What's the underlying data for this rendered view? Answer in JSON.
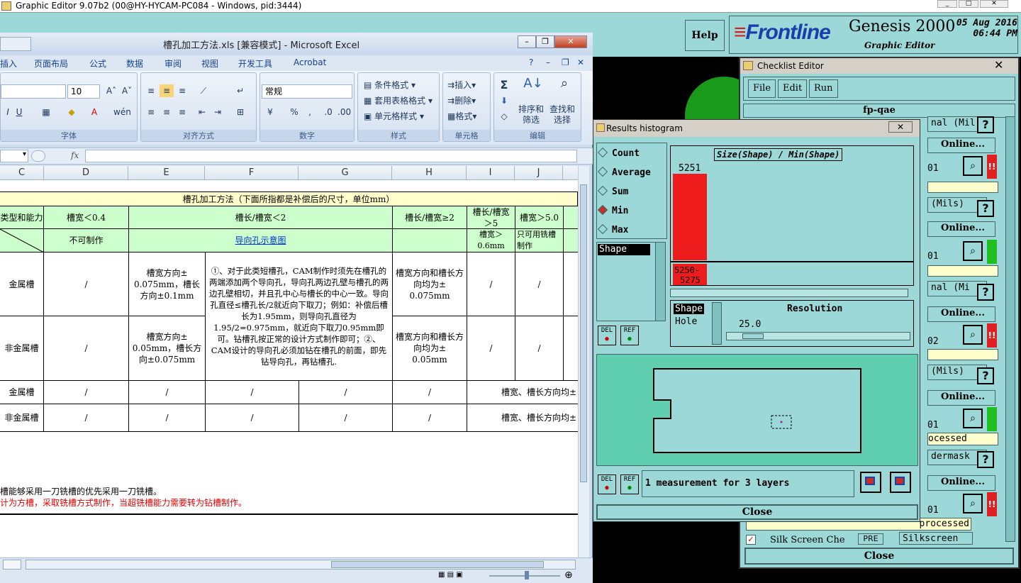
{
  "genesis": {
    "title": "Graphic Editor 9.07b2 (00@HY-HYCAM-PC084 - Windows, pid:3444)",
    "help": "Help",
    "logo": "Frontline",
    "product": "Genesis 2000",
    "subtitle": "Graphic Editor",
    "date": "05 Aug 2016",
    "time": "06:44 PM"
  },
  "excel": {
    "title": "槽孔加工方法.xls  [兼容模式] - Microsoft Excel",
    "tabs": [
      "插入",
      "页面布局",
      "公式",
      "数据",
      "审阅",
      "视图",
      "开发工具",
      "Acrobat"
    ],
    "font_size": "10",
    "number_format": "常规",
    "groups": [
      "字体",
      "对齐方式",
      "数字",
      "样式",
      "单元格",
      "编辑"
    ],
    "styles": {
      "cond": "条件格式",
      "table": "套用表格格式",
      "cell": "单元格样式"
    },
    "cells_grp": {
      "insert": "插入",
      "delete": "删除",
      "format": "格式"
    },
    "edit_grp": {
      "sort": "排序和",
      "sort2": "筛选",
      "find": "查找和",
      "find2": "选择"
    },
    "fx": "fx",
    "columns": [
      "C",
      "D",
      "E",
      "F",
      "G",
      "H",
      "I",
      "J"
    ],
    "sheet": {
      "title": "槽孔加工方法（下面所指都是补偿后的尺寸，单位mm）",
      "h_type": "类型和能力",
      "h_d": "槽宽＜0.4",
      "h_ef": "槽长/槽宽＜2",
      "h_h": "槽长/槽宽≥2",
      "h_i": "槽长/槽宽 ＞5",
      "h_j": "槽宽＞5.0",
      "r2_d": "不可制作",
      "r2_ef": "导向孔示意图",
      "r2_i": "槽宽＞ 0.6mm",
      "r2_j": "只可用铣槽制作",
      "r3_c": "金属槽",
      "r3_d": "/",
      "r3_e": "槽宽方向± 0.075mm，槽长方向±0.1mm",
      "r3_f": "①、对于此类短槽孔，CAM制作时须先在槽孔的两端添加两个导向孔，导向孔两边孔壁与槽孔的两边孔壁相切，并且孔中心与槽长的中心一致。导向孔直径≤槽孔长/2就近向下取刀；例如：补偿后槽长为1.95mm，则导向孔直径为1.95/2=0.975mm，就近向下取刀0.95mm即可。钻槽孔按正常的设计方式制作即可；②、CAM设计的导向孔必须加钻在槽孔的前面，即先钻导向孔，再钻槽孔.",
      "r3_h": "槽宽方向和槽长方向均为± 0.075mm",
      "r3_i": "/",
      "r3_j": "/",
      "r4_c": "非金属槽",
      "r4_d": "/",
      "r4_e": "槽宽方向± 0.05mm，槽长方向±0.075mm",
      "r4_h": "槽宽方向和槽长方向均为± 0.05mm",
      "r4_i": "/",
      "r4_j": "/",
      "r5_c": "金属槽",
      "r5_d": "/",
      "r5_e": "/",
      "r5_f": "/",
      "r5_g": "/",
      "r5_h": "/",
      "r5_ij": "槽宽、槽长方向均±",
      "r6_c": "非金属槽",
      "r6_d": "/",
      "r6_e": "/",
      "r6_f": "/",
      "r6_g": "/",
      "r6_h": "/",
      "r6_ij": "槽宽、槽长方向均±",
      "note1": "槽能够采用一刀铣槽的优先采用一刀铣槽。",
      "note2": "计为方槽，采取铣槽方式制作，当超铣槽能力需要转为钻槽制作。"
    }
  },
  "checklist": {
    "title": "Checklist Editor",
    "menu": [
      "File",
      "Edit",
      "Run"
    ],
    "job": "fp-qae",
    "rows": [
      {
        "text": "nal (Mil",
        "online": "Online...",
        "status": "red",
        "num": "01"
      },
      {
        "text": "(Mils)",
        "online": "Online...",
        "status": "green",
        "num": "01"
      },
      {
        "text": "nal (Mi",
        "online": "Online...",
        "status": "red",
        "num": "02"
      },
      {
        "text": "(Mils)",
        "online": "Online...",
        "status": "green",
        "num": "01"
      },
      {
        "text": "dermask",
        "online": "Online...",
        "status": "red",
        "num": "01"
      }
    ],
    "processed": "ocessed",
    "processed2": "processed",
    "last_item": "Silk Screen Che",
    "last_pre": "PRE",
    "last_lbl": "Silkscreen",
    "close": "Close"
  },
  "histogram": {
    "title": "Results histogram",
    "modes": [
      "Count",
      "Average",
      "Sum",
      "Min",
      "Max"
    ],
    "selected_mode": "Min",
    "list_item": "Shape",
    "plot_title": "Size(Shape) / Min(Shape)",
    "bar_count": "5251",
    "bin_label": "5250- 5275",
    "types": [
      "Shape",
      "Hole"
    ],
    "resolution_label": "Resolution",
    "resolution_value": "25.0",
    "del": "DEL",
    "ref": "REF",
    "summary": "1 measurement for 3 layers",
    "close": "Close"
  },
  "chart_data": {
    "type": "bar",
    "title": "Size(Shape) / Min(Shape)",
    "categories": [
      "5250- 5275"
    ],
    "values": [
      5251
    ]
  },
  "colors": {
    "accent_red": "#ee1c1c",
    "panel": "#9dd8d8",
    "excel_green": "#ccffcc",
    "excel_yellow": "#ffffcc"
  }
}
